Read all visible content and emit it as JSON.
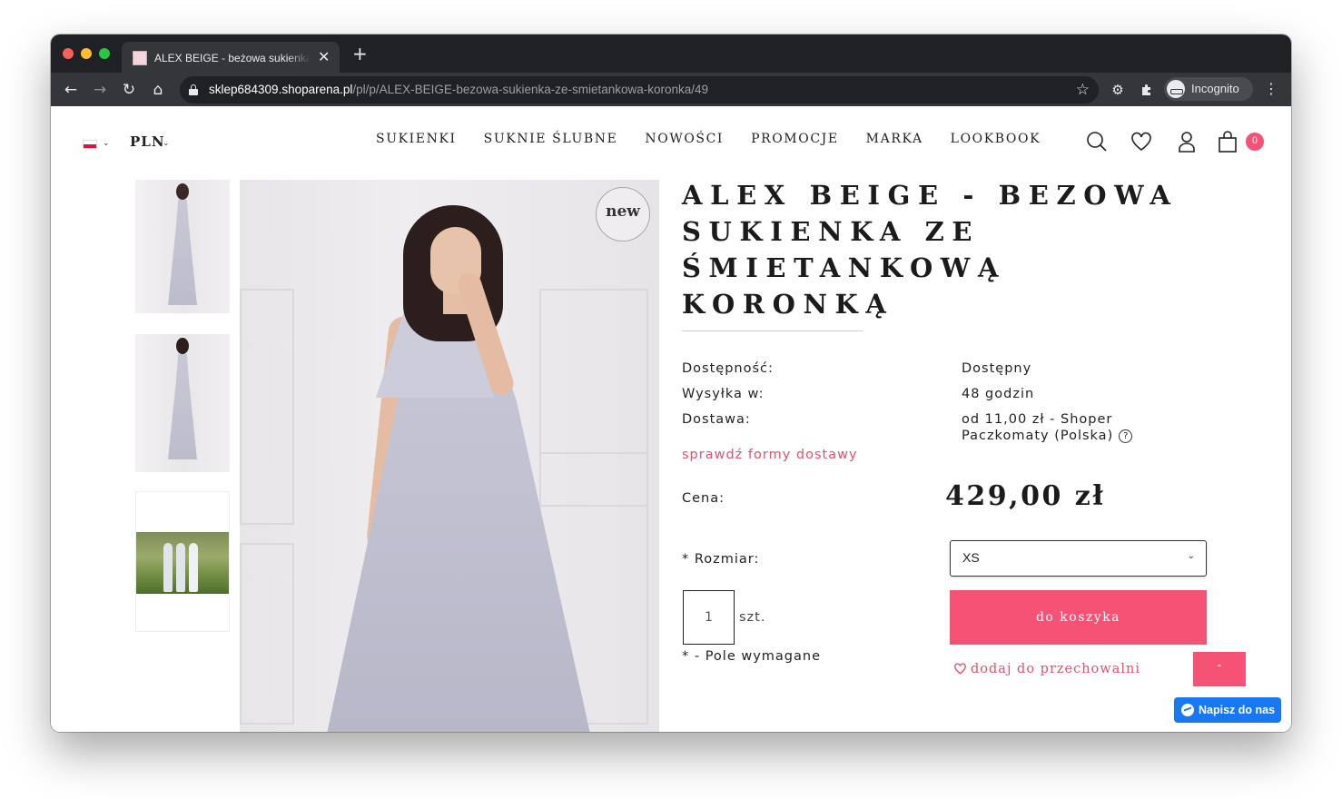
{
  "browser": {
    "tab_title": "ALEX BEIGE - beżowa sukienka ze śmietankową koronką",
    "tab_close": "✕",
    "new_tab": "+",
    "url_host": "sklep684309.shoparena.pl",
    "url_path": "/pl/p/ALEX-BEIGE-bezowa-sukienka-ze-smietankowa-koronka/49",
    "incognito_label": "Incognito"
  },
  "header": {
    "currency": "PLN",
    "nav": [
      "SUKIENKI",
      "SUKNIE ŚLUBNE",
      "NOWOŚCI",
      "PROMOCJE",
      "MARKA",
      "LOOKBOOK"
    ],
    "cart_count": "0"
  },
  "gallery": {
    "badge": "new",
    "thumbnail_count": 3
  },
  "product": {
    "title": "ALEX BEIGE - BEZOWA SUKIENKA ZE ŚMIETANKOWĄ KORONKĄ",
    "availability_label": "Dostępność:",
    "availability_value": "Dostępny",
    "shipping_time_label": "Wysyłka w:",
    "shipping_time_value": "48 godzin",
    "delivery_label": "Dostawa:",
    "delivery_value": "od 11,00 zł - Shoper Paczkomaty (Polska)",
    "shipping_link": "sprawdź formy dostawy",
    "price_label": "Cena:",
    "price": "429,00 zł",
    "size_label": "* Rozmiar:",
    "size_value": "XS",
    "quantity": "1",
    "quantity_unit": "szt.",
    "add_to_cart": "do koszyka",
    "required_note": "* - Pole wymagane",
    "wishlist": "dodaj do przechowalni"
  },
  "chat": {
    "messenger_label": "Napisz do nas"
  },
  "colors": {
    "accent": "#f55275",
    "link": "#e5506e",
    "messenger": "#1877f2"
  }
}
